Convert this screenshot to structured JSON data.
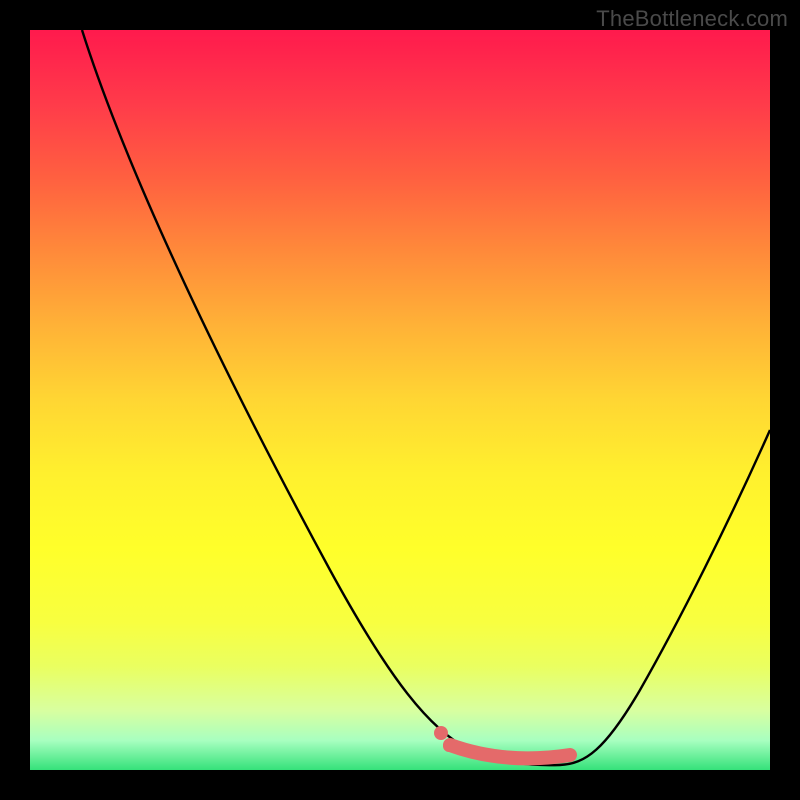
{
  "watermark": "TheBottleneck.com",
  "chart_data": {
    "type": "line",
    "title": "",
    "xlabel": "",
    "ylabel": "",
    "xlim": [
      0,
      100
    ],
    "ylim": [
      0,
      100
    ],
    "grid": false,
    "legend": false,
    "series": [
      {
        "name": "bottleneck-curve",
        "x": [
          7,
          10,
          15,
          20,
          25,
          30,
          35,
          40,
          45,
          50,
          53,
          56,
          60,
          64,
          68,
          72,
          74,
          78,
          82,
          86,
          90,
          95,
          100
        ],
        "y": [
          100,
          96,
          88,
          80,
          72,
          64,
          56,
          48,
          40,
          32,
          24,
          16,
          8,
          3,
          1,
          0.5,
          0.5,
          2,
          8,
          16,
          26,
          40,
          55
        ],
        "color": "#000000"
      },
      {
        "name": "highlight-band",
        "x": [
          56,
          60,
          64,
          68,
          72,
          74
        ],
        "y": [
          3.5,
          2.5,
          2.0,
          2.0,
          2.5,
          3.5
        ],
        "color": "#e46a6a"
      }
    ],
    "annotations": []
  }
}
